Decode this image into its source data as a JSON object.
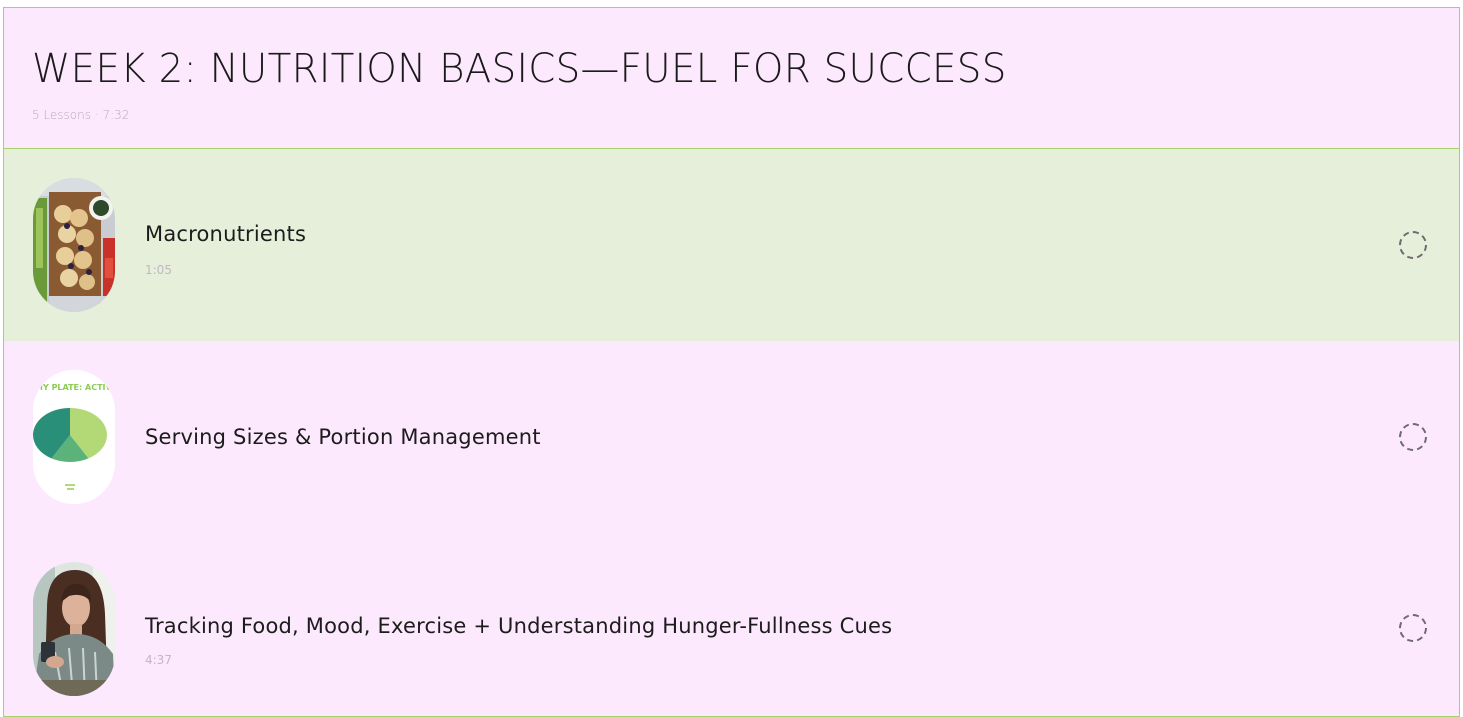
{
  "module": {
    "title": "WEEK 2: NUTRITION BASICS—FUEL FOR SUCCESS",
    "meta": "5 Lessons · 7:32"
  },
  "lessons": [
    {
      "title": "Macronutrients",
      "duration": "1:05",
      "thumbnail": "food-board-image",
      "status": "not-started",
      "active": true
    },
    {
      "title": "Serving Sizes & Portion Management",
      "duration": "",
      "thumbnail": "healthy-plate-chart-image",
      "thumbnail_text": "HY PLATE: ACTIV",
      "status": "not-started",
      "active": false
    },
    {
      "title": "Tracking Food, Mood, Exercise + Understanding Hunger-Fullness Cues",
      "duration": "4:37",
      "thumbnail": "woman-with-phone-image",
      "status": "not-started",
      "active": false
    }
  ],
  "colors": {
    "background": "#fde9fd",
    "active_row": "#e6efda",
    "border": "#a9d16b",
    "status_icon": "#6e6a72"
  }
}
